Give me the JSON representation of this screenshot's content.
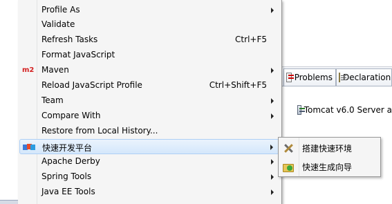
{
  "menu": {
    "items": [
      {
        "label": "Profile As",
        "shortcut": "",
        "submenu": true,
        "icon": ""
      },
      {
        "label": "Validate",
        "shortcut": "",
        "submenu": false,
        "icon": ""
      },
      {
        "label": "Refresh Tasks",
        "shortcut": "Ctrl+F5",
        "submenu": false,
        "icon": ""
      },
      {
        "label": "Format JavaScript",
        "shortcut": "",
        "submenu": false,
        "icon": ""
      },
      {
        "label": "Maven",
        "shortcut": "",
        "submenu": true,
        "icon": "maven-m2-icon",
        "icon_text": "m2"
      },
      {
        "label": "Reload JavaScript Profile",
        "shortcut": "Ctrl+Shift+F5",
        "submenu": false,
        "icon": ""
      },
      {
        "label": "Team",
        "shortcut": "",
        "submenu": true,
        "icon": ""
      },
      {
        "label": "Compare With",
        "shortcut": "",
        "submenu": true,
        "icon": ""
      },
      {
        "label": "Restore from Local History...",
        "shortcut": "",
        "submenu": false,
        "icon": ""
      },
      {
        "label": "快速开发平台",
        "shortcut": "",
        "submenu": true,
        "icon": "colored-cubes-icon",
        "highlighted": true
      },
      {
        "label": "Apache Derby",
        "shortcut": "",
        "submenu": true,
        "icon": ""
      },
      {
        "label": "Spring Tools",
        "shortcut": "",
        "submenu": true,
        "icon": ""
      },
      {
        "label": "Java EE Tools",
        "shortcut": "",
        "submenu": true,
        "icon": ""
      }
    ]
  },
  "submenu": {
    "items": [
      {
        "label": "搭建快速环境",
        "icon": "tools-icon"
      },
      {
        "label": "快速生成向导",
        "icon": "wizard-icon"
      }
    ]
  },
  "views": {
    "tabs": [
      {
        "label": "Problems",
        "icon": "problems-icon"
      },
      {
        "label": "Declaration",
        "icon": "declaration-icon"
      }
    ],
    "server_row": "Tomcat v6.0 Server a"
  },
  "colors": {
    "menu_bg": "#f5f5f5",
    "highlight_bg": "#d4e7fb",
    "highlight_border": "#aecff5",
    "maven_red": "#d42020"
  }
}
